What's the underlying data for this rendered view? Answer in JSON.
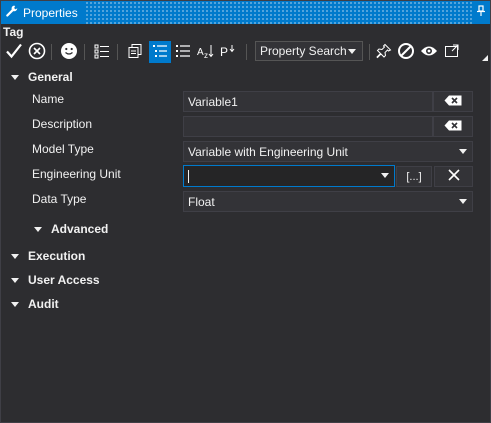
{
  "panel": {
    "title": "Properties",
    "object_name": "Tag"
  },
  "toolbar": {
    "search_label": "Property Search"
  },
  "categories": {
    "general": "General",
    "advanced": "Advanced",
    "execution": "Execution",
    "user_access": "User Access",
    "audit": "Audit"
  },
  "properties": {
    "name": {
      "label": "Name",
      "value": "Variable1"
    },
    "description": {
      "label": "Description",
      "value": ""
    },
    "model_type": {
      "label": "Model Type",
      "value": "Variable with Engineering Unit"
    },
    "engineering_unit": {
      "label": "Engineering Unit",
      "value": "",
      "browse_label": "[...]"
    },
    "data_type": {
      "label": "Data Type",
      "value": "Float"
    }
  },
  "colors": {
    "accent": "#007acc",
    "background": "#2d2d30",
    "field": "#333337",
    "text": "#f1f1f1"
  }
}
